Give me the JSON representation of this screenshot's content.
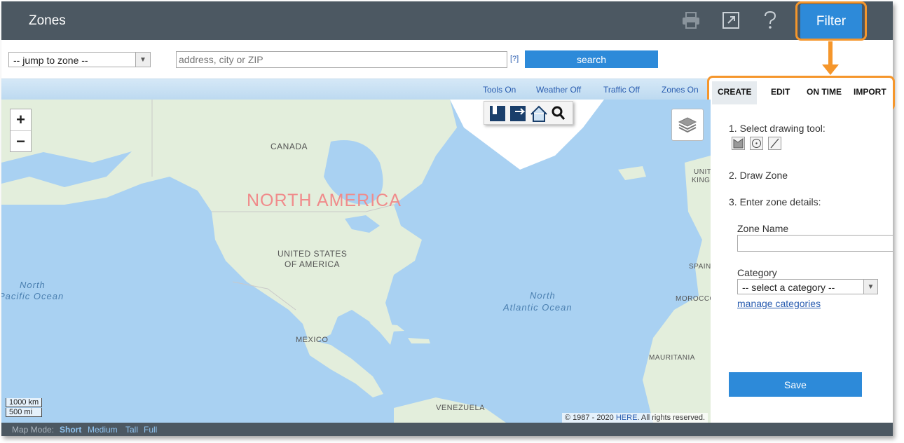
{
  "header": {
    "title": "Zones",
    "filter_label": "Filter",
    "icons": [
      "print-icon",
      "popout-icon",
      "help-icon"
    ]
  },
  "search": {
    "jump_select_value": "-- jump to zone --",
    "address_placeholder": "address, city or ZIP",
    "help_link": "[?]",
    "search_label": "search"
  },
  "toggles": {
    "tools": "Tools On",
    "weather": "Weather Off",
    "traffic": "Traffic Off",
    "zones": "Zones On"
  },
  "tabs": {
    "create": "CREATE",
    "edit": "EDIT",
    "on_time": "ON TIME",
    "import": "IMPORT",
    "active": "CREATE"
  },
  "map": {
    "zoom_in": "+",
    "zoom_out": "−",
    "labels": {
      "continent": "NORTH AMERICA",
      "canada": "CANADA",
      "usa_line1": "UNITED STATES",
      "usa_line2": "OF AMERICA",
      "mexico": "MEXICO",
      "venezuela": "VENEZUELA",
      "spain": "SPAIN",
      "morocco": "MOROCCO",
      "mauritania": "MAURITANIA",
      "uk_line1": "UNIT",
      "uk_line2": "KING",
      "npo_line1": "North",
      "npo_line2": "Pacific Ocean",
      "nao_line1": "North",
      "nao_line2": "Atlantic Ocean"
    },
    "scale_km": "1000 km",
    "scale_mi": "500 mi",
    "copyright_prefix": "© 1987 - 2020 ",
    "copyright_link": "HERE",
    "copyright_suffix": ". All rights reserved."
  },
  "map_mode": {
    "label": "Map Mode:",
    "options": [
      "Short",
      "Medium",
      "Tall",
      "Full"
    ],
    "active": "Short"
  },
  "panel": {
    "step1": "1. Select drawing tool:",
    "step2": "2. Draw Zone",
    "step3": "3. Enter zone details:",
    "zone_name_label": "Zone Name",
    "zone_name_value": "",
    "category_label": "Category",
    "category_value": "-- select a category --",
    "manage_link": "manage categories",
    "save_label": "Save"
  },
  "colors": {
    "header_bg": "#4c5862",
    "accent_blue": "#2d8ad9",
    "highlight_orange": "#f5962b",
    "water": "#a9d1f2",
    "land": "#e3eedc"
  }
}
